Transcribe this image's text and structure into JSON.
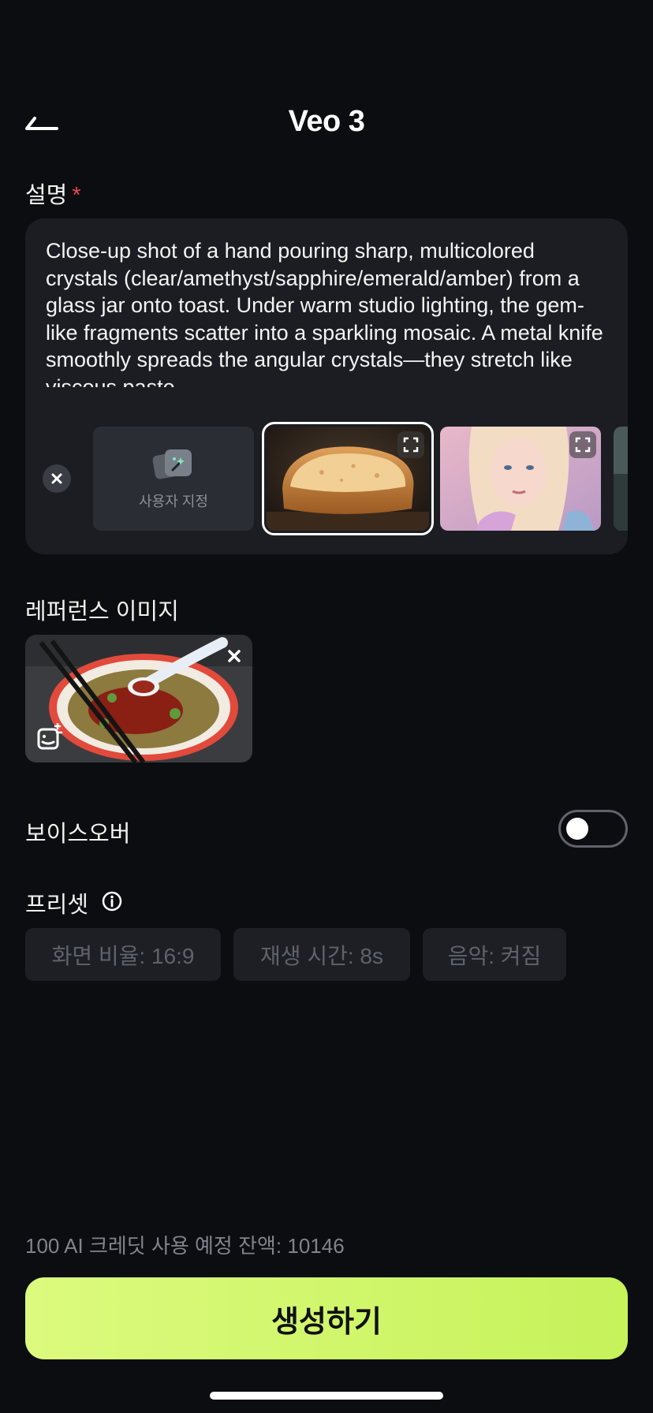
{
  "header": {
    "title": "Veo 3",
    "back_icon": "back-arrow-icon"
  },
  "description": {
    "label": "설명",
    "required_mark": "*",
    "text": "Close-up shot of a hand pouring sharp, multicolored crystals (clear/amethyst/sapphire/emerald/amber) from a glass jar onto toast. Under warm studio lighting, the gem-like fragments scatter into a sparkling mosaic. A metal knife smoothly spreads the angular crystals—they stretch like viscous paste",
    "custom_label": "사용자 지정"
  },
  "reference": {
    "label": "레퍼런스 이미지"
  },
  "voiceover": {
    "label": "보이스오버",
    "enabled": false
  },
  "presets": {
    "label": "프리셋",
    "chips": [
      "화면 비율: 16:9",
      "재생 시간: 8s",
      "음악: 켜짐"
    ]
  },
  "footer": {
    "credits_text": "100 AI 크레딧 사용 예정 잔액: 10146",
    "generate_label": "생성하기"
  },
  "colors": {
    "background": "#0c0d10",
    "card": "#1b1d22",
    "accent": "#cdf466",
    "required": "#e5484d"
  }
}
